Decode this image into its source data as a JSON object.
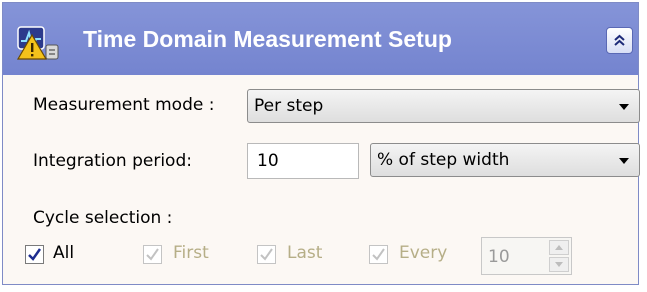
{
  "header": {
    "title": "Time Domain Measurement Setup",
    "icon": "oscilloscope-warning-icon",
    "collapse_icon": "double-chevron-up-icon"
  },
  "measurement_mode": {
    "label": "Measurement mode :",
    "value": "Per step"
  },
  "integration_period": {
    "label": "Integration period:",
    "value": "10",
    "unit": "% of step width"
  },
  "cycle_selection": {
    "label": "Cycle selection :",
    "options": [
      {
        "label": "All",
        "checked": true,
        "enabled": true
      },
      {
        "label": "First",
        "checked": true,
        "enabled": false
      },
      {
        "label": "Last",
        "checked": true,
        "enabled": false
      },
      {
        "label": "Every",
        "checked": true,
        "enabled": false
      }
    ],
    "every_value": "10"
  },
  "colors": {
    "header_bg": "#7d8dd4",
    "disabled_text": "#b6ae87",
    "panel_bg": "#fcf8f4"
  }
}
